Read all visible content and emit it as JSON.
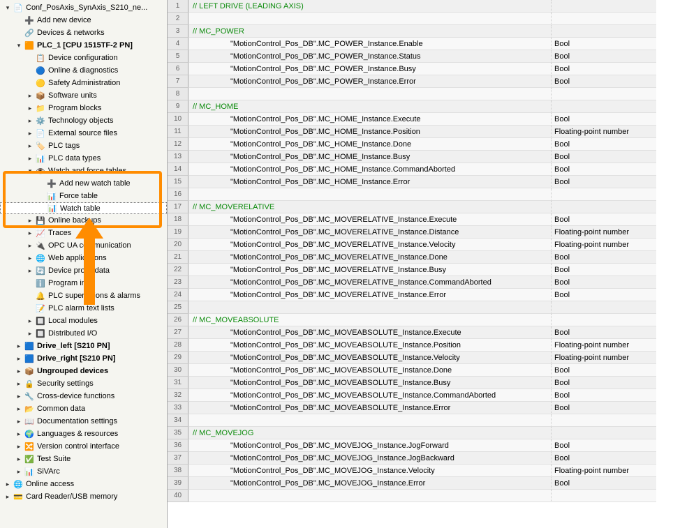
{
  "tree": [
    {
      "depth": 0,
      "tw": "▾",
      "icon": "📄",
      "iconName": "project-icon",
      "label": "Conf_PosAxis_SynAxis_S210_ne...",
      "bold": false
    },
    {
      "depth": 1,
      "tw": "",
      "icon": "➕",
      "iconName": "add-device-icon",
      "label": "Add new device",
      "bold": false
    },
    {
      "depth": 1,
      "tw": "",
      "icon": "🔗",
      "iconName": "devices-networks-icon",
      "label": "Devices & networks",
      "bold": false
    },
    {
      "depth": 1,
      "tw": "▾",
      "icon": "🟧",
      "iconName": "plc-icon",
      "label": "PLC_1 [CPU 1515TF-2 PN]",
      "bold": true
    },
    {
      "depth": 2,
      "tw": "",
      "icon": "📋",
      "iconName": "device-config-icon",
      "label": "Device configuration",
      "bold": false
    },
    {
      "depth": 2,
      "tw": "",
      "icon": "🔵",
      "iconName": "online-diag-icon",
      "label": "Online & diagnostics",
      "bold": false
    },
    {
      "depth": 2,
      "tw": "",
      "icon": "🟡",
      "iconName": "safety-admin-icon",
      "label": "Safety Administration",
      "bold": false
    },
    {
      "depth": 2,
      "tw": "▸",
      "icon": "📦",
      "iconName": "software-units-icon",
      "label": "Software units",
      "bold": false
    },
    {
      "depth": 2,
      "tw": "▸",
      "icon": "📁",
      "iconName": "program-blocks-icon",
      "label": "Program blocks",
      "bold": false
    },
    {
      "depth": 2,
      "tw": "▸",
      "icon": "⚙️",
      "iconName": "tech-objects-icon",
      "label": "Technology objects",
      "bold": false
    },
    {
      "depth": 2,
      "tw": "▸",
      "icon": "📄",
      "iconName": "ext-source-icon",
      "label": "External source files",
      "bold": false
    },
    {
      "depth": 2,
      "tw": "▸",
      "icon": "🏷️",
      "iconName": "plc-tags-icon",
      "label": "PLC tags",
      "bold": false
    },
    {
      "depth": 2,
      "tw": "▸",
      "icon": "📊",
      "iconName": "plc-datatypes-icon",
      "label": "PLC data types",
      "bold": false
    },
    {
      "depth": 2,
      "tw": "▾",
      "icon": "👁️",
      "iconName": "watch-force-icon",
      "label": "Watch and force tables",
      "bold": false
    },
    {
      "depth": 3,
      "tw": "",
      "icon": "➕",
      "iconName": "add-watch-icon",
      "label": "Add new watch table",
      "bold": false
    },
    {
      "depth": 3,
      "tw": "",
      "icon": "📊",
      "iconName": "force-table-icon",
      "label": "Force table",
      "bold": false
    },
    {
      "depth": 3,
      "tw": "",
      "icon": "📊",
      "iconName": "watch-table-icon",
      "label": "Watch table",
      "bold": false,
      "selected": true
    },
    {
      "depth": 2,
      "tw": "▸",
      "icon": "💾",
      "iconName": "online-backups-icon",
      "label": "Online backups",
      "bold": false
    },
    {
      "depth": 2,
      "tw": "▸",
      "icon": "📈",
      "iconName": "traces-icon",
      "label": "Traces",
      "bold": false
    },
    {
      "depth": 2,
      "tw": "▸",
      "icon": "🔌",
      "iconName": "opc-ua-icon",
      "label": "OPC UA communication",
      "bold": false
    },
    {
      "depth": 2,
      "tw": "▸",
      "icon": "🌐",
      "iconName": "web-apps-icon",
      "label": "Web applications",
      "bold": false
    },
    {
      "depth": 2,
      "tw": "▸",
      "icon": "🔄",
      "iconName": "proxy-data-icon",
      "label": "Device proxy data",
      "bold": false
    },
    {
      "depth": 2,
      "tw": "",
      "icon": "ℹ️",
      "iconName": "program-info-icon",
      "label": "Program info",
      "bold": false
    },
    {
      "depth": 2,
      "tw": "",
      "icon": "🔔",
      "iconName": "supervisions-icon",
      "label": "PLC supervisions & alarms",
      "bold": false
    },
    {
      "depth": 2,
      "tw": "",
      "icon": "📝",
      "iconName": "alarm-text-icon",
      "label": "PLC alarm text lists",
      "bold": false
    },
    {
      "depth": 2,
      "tw": "▸",
      "icon": "🔲",
      "iconName": "local-modules-icon",
      "label": "Local modules",
      "bold": false
    },
    {
      "depth": 2,
      "tw": "▸",
      "icon": "🔲",
      "iconName": "dist-io-icon",
      "label": "Distributed I/O",
      "bold": false
    },
    {
      "depth": 1,
      "tw": "▸",
      "icon": "🟦",
      "iconName": "drive-icon",
      "label": "Drive_left [S210 PN]",
      "bold": true
    },
    {
      "depth": 1,
      "tw": "▸",
      "icon": "🟦",
      "iconName": "drive-icon",
      "label": "Drive_right [S210 PN]",
      "bold": true
    },
    {
      "depth": 1,
      "tw": "▸",
      "icon": "📦",
      "iconName": "ungrouped-icon",
      "label": "Ungrouped devices",
      "bold": true
    },
    {
      "depth": 1,
      "tw": "▸",
      "icon": "🔒",
      "iconName": "security-icon",
      "label": "Security settings",
      "bold": false
    },
    {
      "depth": 1,
      "tw": "▸",
      "icon": "🔧",
      "iconName": "cross-device-icon",
      "label": "Cross-device functions",
      "bold": false
    },
    {
      "depth": 1,
      "tw": "▸",
      "icon": "📂",
      "iconName": "common-data-icon",
      "label": "Common data",
      "bold": false
    },
    {
      "depth": 1,
      "tw": "▸",
      "icon": "📖",
      "iconName": "doc-settings-icon",
      "label": "Documentation settings",
      "bold": false
    },
    {
      "depth": 1,
      "tw": "▸",
      "icon": "🌍",
      "iconName": "lang-res-icon",
      "label": "Languages & resources",
      "bold": false
    },
    {
      "depth": 1,
      "tw": "▸",
      "icon": "🔀",
      "iconName": "version-ctrl-icon",
      "label": "Version control interface",
      "bold": false
    },
    {
      "depth": 1,
      "tw": "▸",
      "icon": "✅",
      "iconName": "test-suite-icon",
      "label": "Test Suite",
      "bold": false
    },
    {
      "depth": 1,
      "tw": "▸",
      "icon": "📊",
      "iconName": "sivarc-icon",
      "label": "SiVArc",
      "bold": false
    },
    {
      "depth": 0,
      "tw": "▸",
      "icon": "🌐",
      "iconName": "online-access-icon",
      "label": "Online access",
      "bold": false
    },
    {
      "depth": 0,
      "tw": "▸",
      "icon": "💳",
      "iconName": "card-reader-icon",
      "label": "Card Reader/USB memory",
      "bold": false
    }
  ],
  "rows": [
    {
      "n": 1,
      "name": "// LEFT DRIVE (LEADING AXIS)",
      "type": "",
      "comment": true
    },
    {
      "n": 2,
      "name": "",
      "type": ""
    },
    {
      "n": 3,
      "name": "// MC_POWER",
      "type": "",
      "comment": true
    },
    {
      "n": 4,
      "name": "\"MotionControl_Pos_DB\".MC_POWER_Instance.Enable",
      "type": "Bool",
      "var": true
    },
    {
      "n": 5,
      "name": "\"MotionControl_Pos_DB\".MC_POWER_Instance.Status",
      "type": "Bool",
      "var": true
    },
    {
      "n": 6,
      "name": "\"MotionControl_Pos_DB\".MC_POWER_Instance.Busy",
      "type": "Bool",
      "var": true
    },
    {
      "n": 7,
      "name": "\"MotionControl_Pos_DB\".MC_POWER_Instance.Error",
      "type": "Bool",
      "var": true
    },
    {
      "n": 8,
      "name": "",
      "type": ""
    },
    {
      "n": 9,
      "name": "// MC_HOME",
      "type": "",
      "comment": true
    },
    {
      "n": 10,
      "name": "\"MotionControl_Pos_DB\".MC_HOME_Instance.Execute",
      "type": "Bool",
      "var": true
    },
    {
      "n": 11,
      "name": "\"MotionControl_Pos_DB\".MC_HOME_Instance.Position",
      "type": "Floating-point number",
      "var": true
    },
    {
      "n": 12,
      "name": "\"MotionControl_Pos_DB\".MC_HOME_Instance.Done",
      "type": "Bool",
      "var": true
    },
    {
      "n": 13,
      "name": "\"MotionControl_Pos_DB\".MC_HOME_Instance.Busy",
      "type": "Bool",
      "var": true
    },
    {
      "n": 14,
      "name": "\"MotionControl_Pos_DB\".MC_HOME_Instance.CommandAborted",
      "type": "Bool",
      "var": true
    },
    {
      "n": 15,
      "name": "\"MotionControl_Pos_DB\".MC_HOME_Instance.Error",
      "type": "Bool",
      "var": true
    },
    {
      "n": 16,
      "name": "",
      "type": ""
    },
    {
      "n": 17,
      "name": "// MC_MOVERELATIVE",
      "type": "",
      "comment": true
    },
    {
      "n": 18,
      "name": "\"MotionControl_Pos_DB\".MC_MOVERELATIVE_Instance.Execute",
      "type": "Bool",
      "var": true
    },
    {
      "n": 19,
      "name": "\"MotionControl_Pos_DB\".MC_MOVERELATIVE_Instance.Distance",
      "type": "Floating-point number",
      "var": true
    },
    {
      "n": 20,
      "name": "\"MotionControl_Pos_DB\".MC_MOVERELATIVE_Instance.Velocity",
      "type": "Floating-point number",
      "var": true
    },
    {
      "n": 21,
      "name": "\"MotionControl_Pos_DB\".MC_MOVERELATIVE_Instance.Done",
      "type": "Bool",
      "var": true
    },
    {
      "n": 22,
      "name": "\"MotionControl_Pos_DB\".MC_MOVERELATIVE_Instance.Busy",
      "type": "Bool",
      "var": true
    },
    {
      "n": 23,
      "name": "\"MotionControl_Pos_DB\".MC_MOVERELATIVE_Instance.CommandAborted",
      "type": "Bool",
      "var": true
    },
    {
      "n": 24,
      "name": "\"MotionControl_Pos_DB\".MC_MOVERELATIVE_Instance.Error",
      "type": "Bool",
      "var": true
    },
    {
      "n": 25,
      "name": "",
      "type": ""
    },
    {
      "n": 26,
      "name": "// MC_MOVEABSOLUTE",
      "type": "",
      "comment": true
    },
    {
      "n": 27,
      "name": "\"MotionControl_Pos_DB\".MC_MOVEABSOLUTE_Instance.Execute",
      "type": "Bool",
      "var": true
    },
    {
      "n": 28,
      "name": "\"MotionControl_Pos_DB\".MC_MOVEABSOLUTE_Instance.Position",
      "type": "Floating-point number",
      "var": true
    },
    {
      "n": 29,
      "name": "\"MotionControl_Pos_DB\".MC_MOVEABSOLUTE_Instance.Velocity",
      "type": "Floating-point number",
      "var": true
    },
    {
      "n": 30,
      "name": "\"MotionControl_Pos_DB\".MC_MOVEABSOLUTE_Instance.Done",
      "type": "Bool",
      "var": true
    },
    {
      "n": 31,
      "name": "\"MotionControl_Pos_DB\".MC_MOVEABSOLUTE_Instance.Busy",
      "type": "Bool",
      "var": true
    },
    {
      "n": 32,
      "name": "\"MotionControl_Pos_DB\".MC_MOVEABSOLUTE_Instance.CommandAborted",
      "type": "Bool",
      "var": true
    },
    {
      "n": 33,
      "name": "\"MotionControl_Pos_DB\".MC_MOVEABSOLUTE_Instance.Error",
      "type": "Bool",
      "var": true
    },
    {
      "n": 34,
      "name": "",
      "type": ""
    },
    {
      "n": 35,
      "name": "// MC_MOVEJOG",
      "type": "",
      "comment": true
    },
    {
      "n": 36,
      "name": "\"MotionControl_Pos_DB\".MC_MOVEJOG_Instance.JogForward",
      "type": "Bool",
      "var": true
    },
    {
      "n": 37,
      "name": "\"MotionControl_Pos_DB\".MC_MOVEJOG_Instance.JogBackward",
      "type": "Bool",
      "var": true
    },
    {
      "n": 38,
      "name": "\"MotionControl_Pos_DB\".MC_MOVEJOG_Instance.Velocity",
      "type": "Floating-point number",
      "var": true
    },
    {
      "n": 39,
      "name": "\"MotionControl_Pos_DB\".MC_MOVEJOG_Instance.Error",
      "type": "Bool",
      "var": true
    },
    {
      "n": 40,
      "name": "",
      "type": ""
    }
  ]
}
